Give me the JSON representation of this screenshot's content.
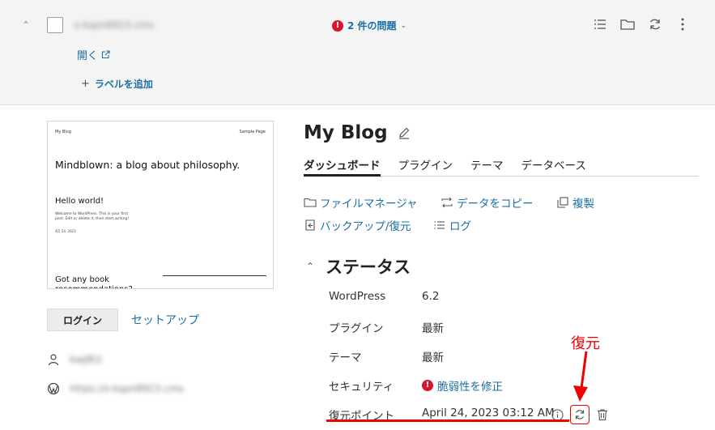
{
  "header": {
    "domain": "s-kqsn8923.cms",
    "issues": "2 件の問題",
    "open_link": "開く",
    "add_label": "ラベルを追加"
  },
  "preview": {
    "site_name": "My Blog",
    "sample_page": "Sample Page",
    "heading": "Mindblown: a blog about philosophy.",
    "post_title": "Hello world!",
    "post_text": "Welcome to WordPress. This is your first post. Edit or delete it, then start writing!",
    "post_date": "4月 24, 2023",
    "next_heading": "Got any book recommendations?"
  },
  "sidebar": {
    "login_button": "ログイン",
    "setup_link": "セットアップ",
    "user": "kwj8t2",
    "site_url": "https://s-kqsn8923.cms"
  },
  "site": {
    "title": "My Blog",
    "tabs": [
      "ダッシュボード",
      "プラグイン",
      "テーマ",
      "データベース"
    ],
    "actions": {
      "file_manager": "ファイルマネージャ",
      "copy_data": "データをコピー",
      "duplicate": "複製",
      "backup": "バックアップ/復元",
      "log": "ログ"
    }
  },
  "status": {
    "heading": "ステータス",
    "rows": [
      {
        "label": "WordPress",
        "value": "6.2"
      },
      {
        "label": "プラグイン",
        "value": "最新"
      },
      {
        "label": "テーマ",
        "value": "最新"
      },
      {
        "label": "セキュリティ",
        "value": "脆弱性を修正"
      },
      {
        "label": "復元ポイント",
        "value": "April 24, 2023 03:12 AM"
      }
    ]
  },
  "annotation": {
    "label": "復元",
    "color": "#e00000"
  },
  "colors": {
    "link": "#1a6fa3",
    "error": "#d8162b"
  }
}
